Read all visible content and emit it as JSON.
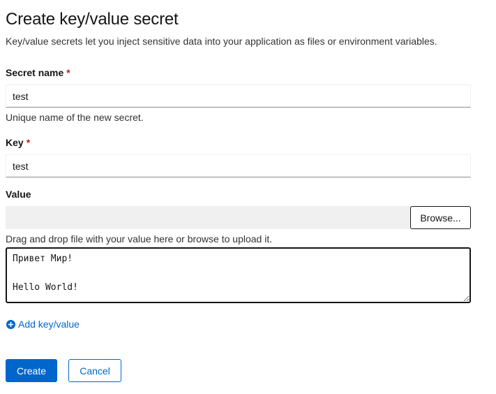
{
  "page": {
    "title": "Create key/value secret",
    "subtitle": "Key/value secrets let you inject sensitive data into your application as files or environment variables."
  },
  "secret_name": {
    "label": "Secret name",
    "required_marker": "*",
    "value": "test",
    "helper": "Unique name of the new secret."
  },
  "key": {
    "label": "Key",
    "required_marker": "*",
    "value": "test"
  },
  "value_field": {
    "label": "Value",
    "browse_label": "Browse...",
    "helper": "Drag and drop file with your value here or browse to upload it.",
    "text": "Привет Мир!\n\nHello World!"
  },
  "add_link": {
    "label": "Add key/value",
    "icon": "plus-circle-icon"
  },
  "actions": {
    "create_label": "Create",
    "cancel_label": "Cancel"
  },
  "colors": {
    "primary": "#0066cc",
    "required": "#c9190b",
    "text": "#151515"
  }
}
